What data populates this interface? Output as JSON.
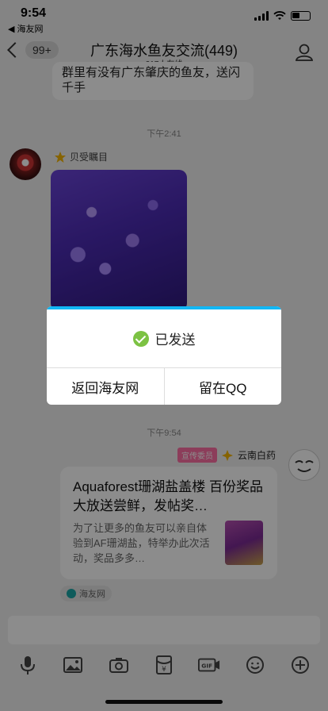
{
  "status": {
    "time": "9:54",
    "back_app": "◀ 海友网"
  },
  "header": {
    "back_badge": "99+",
    "title": "广东海水鱼友交流(449)",
    "online": "217人在线"
  },
  "messages": {
    "top_text": "群里有没有广东肇庆的鱼友，送闪千手",
    "time1": "下午2:41",
    "sender_name": "贝受瞩目",
    "time2": "下午9:54",
    "right_role": "宣传委员",
    "right_name": "云南白药",
    "card_title": "Aquaforest珊湖盐盖楼 百份奖品大放送尝鲜，发帖奖…",
    "card_desc": "为了让更多的鱼友可以亲自体验到AF珊湖盐，特举办此次活动，奖品多多…",
    "source": "海友网"
  },
  "modal": {
    "message": "已发送",
    "left_button": "返回海友网",
    "right_button": "留在QQ"
  },
  "colors": {
    "accent": "#12b7f5",
    "success": "#7cc243",
    "role_tag": "#ff6fa5"
  },
  "icons": [
    "mic-icon",
    "image-icon",
    "camera-icon",
    "red-packet-icon",
    "gif-icon",
    "emoji-icon",
    "plus-icon"
  ]
}
